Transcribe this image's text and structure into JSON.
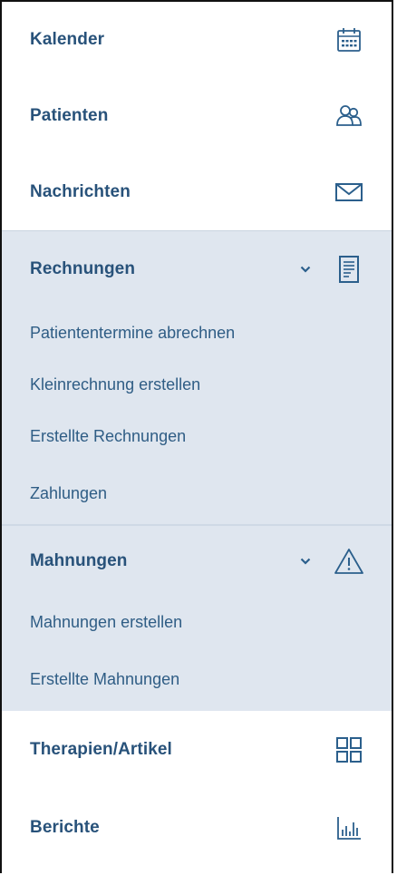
{
  "nav": {
    "items_top": [
      {
        "label": "Kalender",
        "icon": "calendar-icon"
      },
      {
        "label": "Patienten",
        "icon": "users-icon"
      },
      {
        "label": "Nachrichten",
        "icon": "envelope-icon"
      }
    ],
    "rechnungen": {
      "label": "Rechnungen",
      "icon": "invoice-icon",
      "expanded": true,
      "subitems": [
        "Patiententermine abrechnen",
        "Kleinrechnung erstellen",
        "Erstellte Rechnungen",
        "Zahlungen"
      ]
    },
    "mahnungen": {
      "label": "Mahnungen",
      "icon": "warning-icon",
      "expanded": true,
      "subitems": [
        "Mahnungen erstellen",
        "Erstellte Mahnungen"
      ]
    },
    "items_bottom": [
      {
        "label": "Therapien/Artikel",
        "icon": "grid-icon"
      },
      {
        "label": "Berichte",
        "icon": "bar-chart-icon"
      }
    ]
  },
  "colors": {
    "label": "#28527a",
    "subitem": "#2f5d85",
    "icon": "#2b5f8c",
    "group_background": "#dfe6ef"
  }
}
